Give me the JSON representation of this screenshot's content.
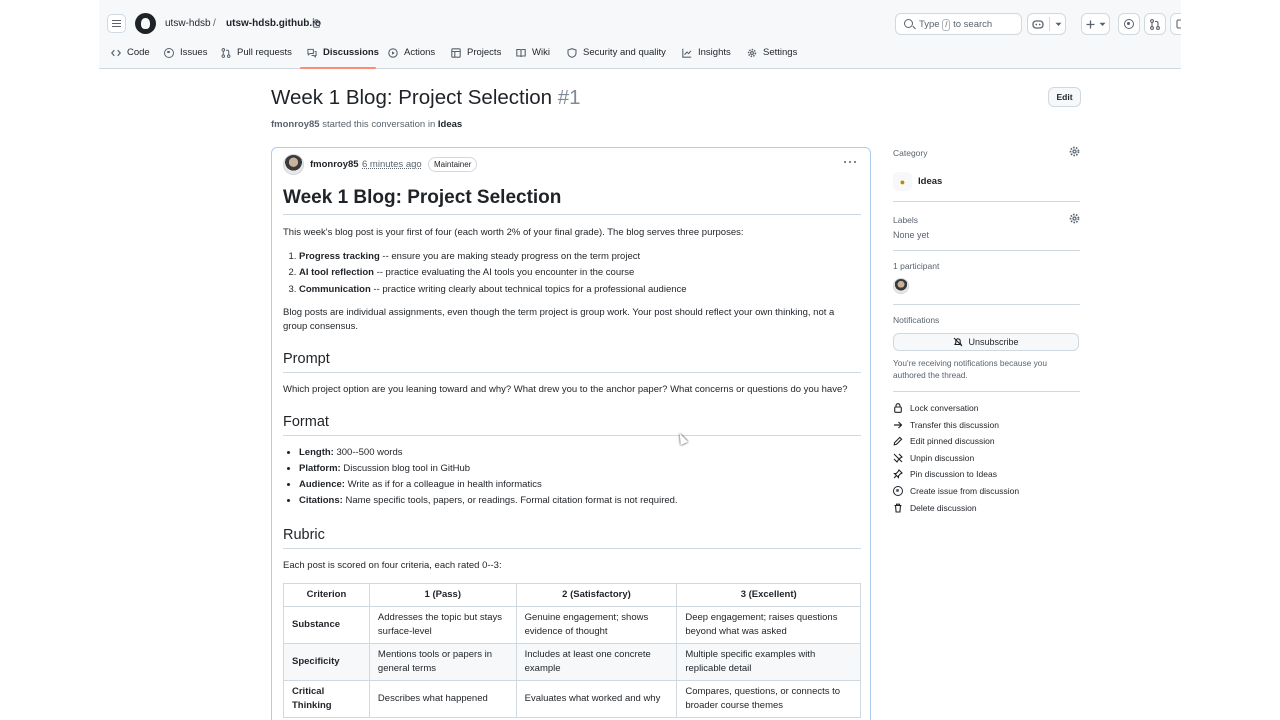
{
  "header": {
    "owner": "utsw-hdsb",
    "separator": "/",
    "repo": "utsw-hdsb.github.io",
    "search_text_before": "Type",
    "search_key": "/",
    "search_text_after": "to search"
  },
  "tabs": [
    {
      "label": "Code",
      "icon": "code-icon"
    },
    {
      "label": "Issues",
      "icon": "issue-icon"
    },
    {
      "label": "Pull requests",
      "icon": "pull-request-icon"
    },
    {
      "label": "Discussions",
      "icon": "comment-discussion-icon",
      "active": true
    },
    {
      "label": "Actions",
      "icon": "play-icon"
    },
    {
      "label": "Projects",
      "icon": "table-icon"
    },
    {
      "label": "Wiki",
      "icon": "book-icon"
    },
    {
      "label": "Security and quality",
      "icon": "shield-icon"
    },
    {
      "label": "Insights",
      "icon": "graph-icon"
    },
    {
      "label": "Settings",
      "icon": "gear-icon"
    }
  ],
  "discussion": {
    "title": "Week 1 Blog: Project Selection",
    "number": "#1",
    "edit_label": "Edit",
    "starter": "fmonroy85",
    "started_text": "started this conversation in",
    "category": "Ideas"
  },
  "post": {
    "author": "fmonroy85",
    "time": "6 minutes ago",
    "badge": "Maintainer",
    "heading": "Week 1 Blog: Project Selection",
    "intro": "This week's blog post is your first of four (each worth 2% of your final grade). The blog serves three purposes:",
    "purposes": [
      {
        "bold": "Progress tracking",
        "text": " -- ensure you are making steady progress on the term project"
      },
      {
        "bold": "AI tool reflection",
        "text": " -- practice evaluating the AI tools you encounter in the course"
      },
      {
        "bold": "Communication",
        "text": " -- practice writing clearly about technical topics for a professional audience"
      }
    ],
    "individual": "Blog posts are individual assignments, even though the term project is group work. Your post should reflect your own thinking, not a group consensus.",
    "prompt_heading": "Prompt",
    "prompt_text": "Which project option are you leaning toward and why? What drew you to the anchor paper? What concerns or questions do you have?",
    "format_heading": "Format",
    "format_items": [
      {
        "bold": "Length:",
        "text": " 300--500 words"
      },
      {
        "bold": "Platform:",
        "text": " Discussion blog tool in GitHub"
      },
      {
        "bold": "Audience:",
        "text": " Write as if for a colleague in health informatics"
      },
      {
        "bold": "Citations:",
        "text": " Name specific tools, papers, or readings. Formal citation format is not required."
      }
    ],
    "rubric_heading": "Rubric",
    "rubric_intro": "Each post is scored on four criteria, each rated 0--3:",
    "rubric": {
      "headers": [
        "Criterion",
        "1 (Pass)",
        "2 (Satisfactory)",
        "3 (Excellent)"
      ],
      "rows": [
        [
          "Substance",
          "Addresses the topic but stays surface-level",
          "Genuine engagement; shows evidence of thought",
          "Deep engagement; raises questions beyond what was asked"
        ],
        [
          "Specificity",
          "Mentions tools or papers in general terms",
          "Includes at least one concrete example",
          "Multiple specific examples with replicable detail"
        ],
        [
          "Critical Thinking",
          "Describes what happened",
          "Evaluates what worked and why",
          "Compares, questions, or connects to broader course themes"
        ]
      ]
    }
  },
  "sidebar": {
    "category_label": "Category",
    "category_value": "Ideas",
    "labels_label": "Labels",
    "labels_value": "None yet",
    "participants_label": "1 participant",
    "notifications_label": "Notifications",
    "unsubscribe_label": "Unsubscribe",
    "notifications_note": "You're receiving notifications because you authored the thread.",
    "actions": [
      {
        "label": "Lock conversation",
        "icon": "lock-icon"
      },
      {
        "label": "Transfer this discussion",
        "icon": "arrow-right-icon"
      },
      {
        "label": "Edit pinned discussion",
        "icon": "pencil-icon"
      },
      {
        "label": "Unpin discussion",
        "icon": "pin-slash-icon"
      },
      {
        "label": "Pin discussion to Ideas",
        "icon": "pin-icon"
      },
      {
        "label": "Create issue from discussion",
        "icon": "issue-opened-icon"
      },
      {
        "label": "Delete discussion",
        "icon": "trash-icon"
      }
    ]
  },
  "colors": {
    "accent_underline": "#fd8c73",
    "text": "#1f2328",
    "muted": "#59636e",
    "border": "#d1d9e0",
    "header_bg": "#f6f8fa"
  }
}
